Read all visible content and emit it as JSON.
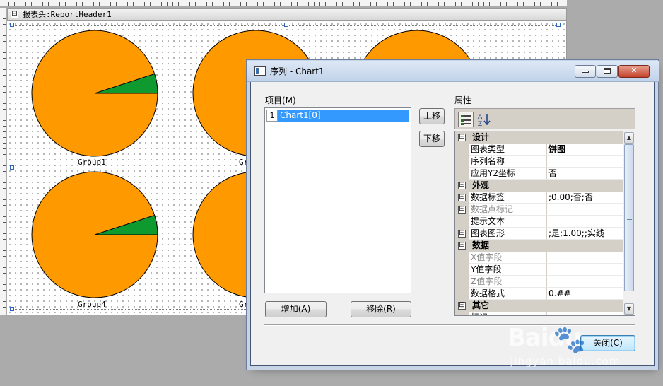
{
  "designer": {
    "band_toggle": "⊟",
    "band_title": "报表头:ReportHeader1",
    "charts": [
      {
        "label": "Group1",
        "slice_fraction": 0.05
      },
      {
        "label": "Gr",
        "slice_fraction": 0
      },
      {
        "label": "",
        "slice_fraction": 0
      },
      {
        "label": "Group4",
        "slice_fraction": 0.05
      },
      {
        "label": "Gr",
        "slice_fraction": 0
      }
    ],
    "colors": {
      "pie_main": "#ff9900",
      "pie_slice": "#0e9a2f"
    }
  },
  "dialog": {
    "title": "序列 - Chart1",
    "items_label": "项目(M)",
    "items": [
      {
        "index": "1",
        "name": "Chart1[0]"
      }
    ],
    "buttons": {
      "move_up": "上移",
      "move_down": "下移",
      "add": "增加(A)",
      "remove": "移除(R)",
      "close": "关闭(C)"
    },
    "properties_label": "属性",
    "property_grid": [
      {
        "type": "category",
        "toggle": "⊟",
        "name": "设计"
      },
      {
        "type": "prop",
        "toggle": "",
        "name": "图表类型",
        "value": "饼图",
        "bold": true
      },
      {
        "type": "prop",
        "toggle": "",
        "name": "序列名称",
        "value": ""
      },
      {
        "type": "prop",
        "toggle": "",
        "name": "应用Y2坐标",
        "value": "否"
      },
      {
        "type": "category",
        "toggle": "⊟",
        "name": "外观"
      },
      {
        "type": "prop",
        "toggle": "⊞",
        "name": "数据标签",
        "value": ";0.00;否;否"
      },
      {
        "type": "prop",
        "toggle": "⊞",
        "name": "数据点标记",
        "value": "",
        "disabled": true
      },
      {
        "type": "prop",
        "toggle": "",
        "name": "提示文本",
        "value": ""
      },
      {
        "type": "prop",
        "toggle": "⊞",
        "name": "图表图形",
        "value": ";是;1.00;;实线"
      },
      {
        "type": "category",
        "toggle": "⊟",
        "name": "数据"
      },
      {
        "type": "prop",
        "toggle": "",
        "name": "X值字段",
        "value": "",
        "disabled": true
      },
      {
        "type": "prop",
        "toggle": "",
        "name": "Y值字段",
        "value": ""
      },
      {
        "type": "prop",
        "toggle": "",
        "name": "Z值字段",
        "value": "",
        "disabled": true
      },
      {
        "type": "prop",
        "toggle": "",
        "name": "数据格式",
        "value": "0.##"
      },
      {
        "type": "category",
        "toggle": "⊟",
        "name": "其它"
      },
      {
        "type": "prop",
        "toggle": "",
        "name": "标记",
        "value": ""
      }
    ]
  },
  "watermark": {
    "main": "Baidu",
    "paw": "🐾",
    "sub": "jingyan.baidu.com"
  }
}
